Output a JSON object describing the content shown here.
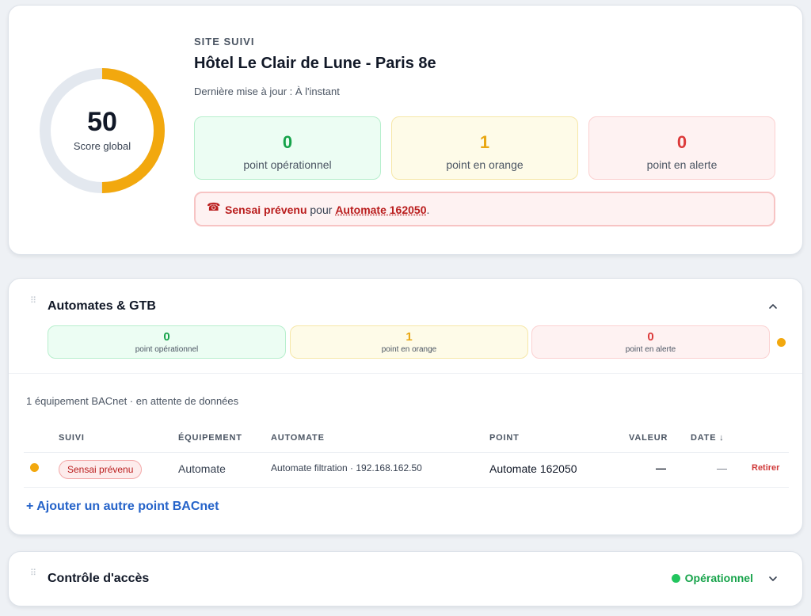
{
  "summary": {
    "score": "50",
    "score_label": "Score global",
    "score_fraction": 0.5,
    "eyebrow": "SITE SUIVI",
    "site_name": "Hôtel Le Clair de Lune - Paris 8e",
    "updated": "Dernière mise à jour : À l'instant",
    "stats": [
      {
        "value": "0",
        "label": "point opérationnel"
      },
      {
        "value": "1",
        "label": "point en orange"
      },
      {
        "value": "0",
        "label": "point en alerte"
      }
    ],
    "alert": {
      "icon": "phone-icon",
      "strong": "Sensai prévenu",
      "middle": " pour ",
      "link": "Automate 162050",
      "end": "."
    }
  },
  "automates": {
    "title": "Automates & GTB",
    "stats": [
      {
        "value": "0",
        "label": "point opérationnel"
      },
      {
        "value": "1",
        "label": "point en orange"
      },
      {
        "value": "0",
        "label": "point en alerte"
      }
    ],
    "equip_note": "1 équipement BACnet · en attente de données",
    "columns": [
      "SUIVI",
      "ÉQUIPEMENT",
      "AUTOMATE",
      "POINT",
      "VALEUR",
      "DATE ↓"
    ],
    "row": {
      "suivi": "Sensai prévenu",
      "equipement": "Automate",
      "automate": "Automate filtration · 192.168.162.50",
      "point": "Automate 162050",
      "valeur": "—",
      "date": "—",
      "action": "Retirer"
    },
    "add_link": "+ Ajouter un autre point BACnet"
  },
  "acces": {
    "title": "Contrôle d'accès",
    "status": "Opérationnel"
  },
  "colors": {
    "orange": "#f2a80e",
    "green": "#16a34a",
    "red": "#dc3a3a",
    "link_blue": "#2563c9"
  }
}
